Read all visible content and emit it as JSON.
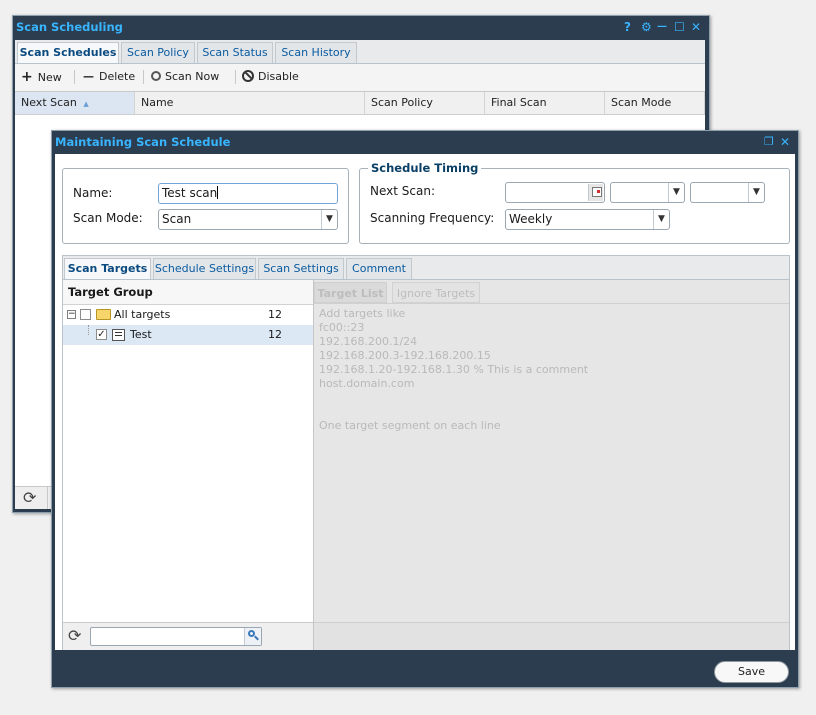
{
  "back_window": {
    "title": "Scan Scheduling",
    "title_controls": [
      "?",
      "⚙",
      "—",
      "☐",
      "✕"
    ],
    "tabs": [
      {
        "label": "Scan Schedules",
        "active": true
      },
      {
        "label": "Scan Policy",
        "active": false
      },
      {
        "label": "Scan Status",
        "active": false
      },
      {
        "label": "Scan History",
        "active": false
      }
    ],
    "toolbar": {
      "new_label": "New",
      "delete_label": "Delete",
      "scan_now_label": "Scan Now",
      "disable_label": "Disable"
    },
    "columns": [
      "Next Scan",
      "Name",
      "Scan Policy",
      "Final Scan",
      "Scan Mode"
    ],
    "sort_column": "Next Scan"
  },
  "dialog": {
    "title": "Maintaining Scan Schedule",
    "name_label": "Name:",
    "name_value": "Test scan",
    "scan_mode_label": "Scan Mode:",
    "scan_mode_value": "Scan",
    "timing_legend": "Schedule Timing",
    "next_scan_label": "Next Scan:",
    "next_scan_date": "",
    "next_scan_hour": "",
    "next_scan_minute": "",
    "frequency_label": "Scanning Frequency:",
    "frequency_value": "Weekly",
    "tabs": [
      {
        "label": "Scan Targets",
        "active": true
      },
      {
        "label": "Schedule Settings",
        "active": false
      },
      {
        "label": "Scan Settings",
        "active": false
      },
      {
        "label": "Comment",
        "active": false
      }
    ],
    "target_group_header": "Target Group",
    "tree": [
      {
        "label": "All targets",
        "count": "12",
        "checked": false,
        "expanded": true
      },
      {
        "label": "Test",
        "count": "12",
        "checked": true,
        "selected": true
      }
    ],
    "search_value": "",
    "target_subtabs": [
      "Target List",
      "Ignore Targets"
    ],
    "target_hint_lines": [
      "Add targets like",
      "fc00::23",
      "192.168.200.1/24",
      "192.168.200.3-192.168.200.15",
      "192.168.1.20-192.168.1.30 % This is a comment",
      "host.domain.com",
      "",
      "",
      "One target segment on each line"
    ],
    "save_label": "Save"
  },
  "colors": {
    "window_frame": "#2b3d4f",
    "title_text": "#39b4ff",
    "tab_text": "#0a5ba0",
    "selected_row": "#dde8f5"
  }
}
